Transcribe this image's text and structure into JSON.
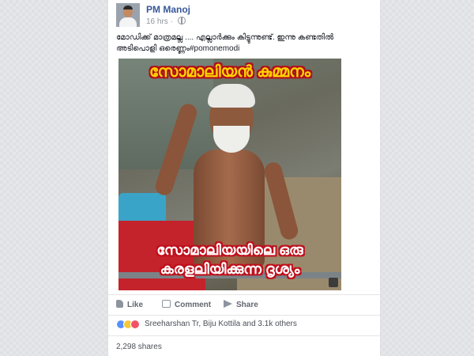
{
  "post": {
    "author": "PM Manoj",
    "timestamp": "16 hrs",
    "privacy_icon": "globe-icon",
    "text": "മോഡിക്ക് മാത്രമല്ല .... എല്ലാർക്കും കിട്ടുന്നുണ്ട്. ഇന്നു കണ്ടതിൽ അടിപൊളി ഒരെണ്ണം#pomonemodi"
  },
  "image": {
    "caption_top": "സോമാലിയൻ കുമ്മനം",
    "caption_bottom_line1": "സോമാലിയയിലെ ഒരു",
    "caption_bottom_line2": "കരളലിയിക്കുന്ന ദൃശ്യം"
  },
  "actions": {
    "like": "Like",
    "comment": "Comment",
    "share": "Share"
  },
  "reactions": {
    "summary": "Sreeharshan Tr, Biju Kottila and 3.1k others"
  },
  "shares": {
    "count": "2,298 shares"
  },
  "colors": {
    "link": "#365899",
    "background": "#e9ebee",
    "caption_yellow": "#ffd200",
    "caption_red": "#b0101a"
  }
}
